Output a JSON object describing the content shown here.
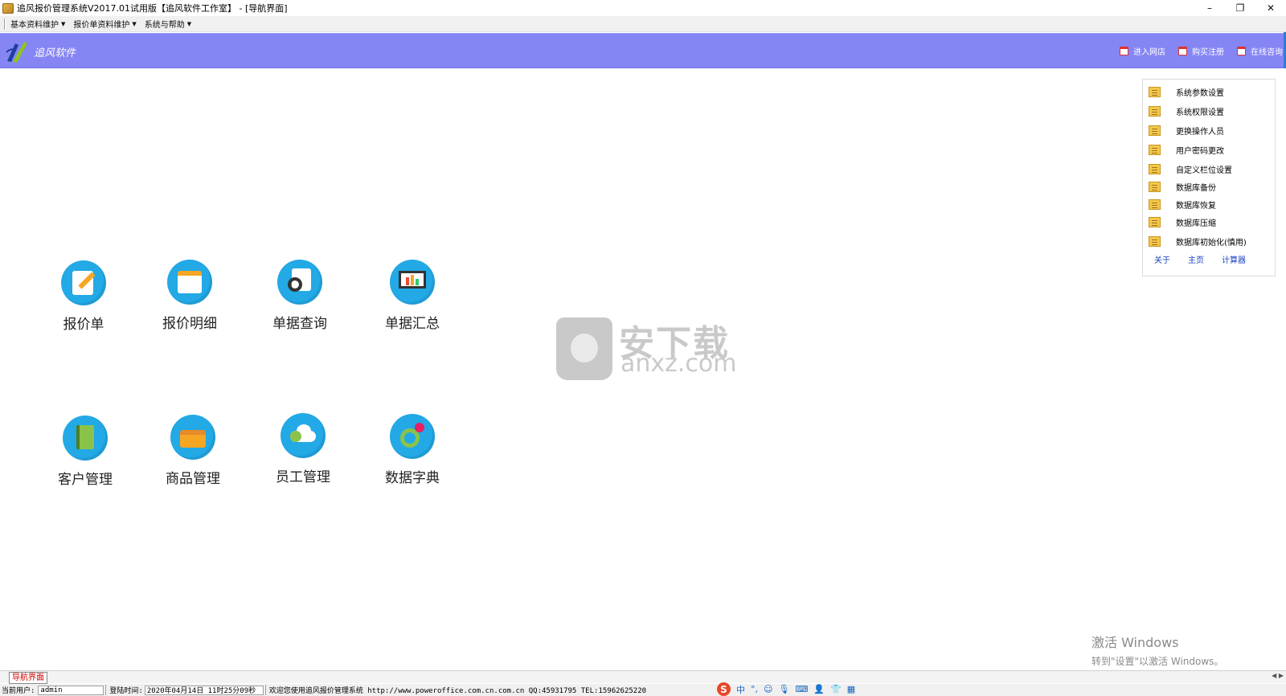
{
  "window": {
    "title": "追风报价管理系统V2017.01试用版【追风软件工作室】 - [导航界面]",
    "controls": [
      "–",
      "❐",
      "✕"
    ]
  },
  "menu": {
    "items": [
      "基本资料维护",
      "报价单资料维护",
      "系统与帮助"
    ]
  },
  "banner": {
    "brand": "追风软件",
    "links": [
      "进入网店",
      "购买注册",
      "在线咨询"
    ]
  },
  "side_panel": {
    "items": [
      "系统参数设置",
      "系统权限设置",
      "更换操作人员",
      "用户密码更改",
      "自定义栏位设置",
      "数据库备份",
      "数据库恢复",
      "数据库压缩",
      "数据库初始化(慎用)"
    ],
    "links": [
      "关于",
      "主页",
      "计算器"
    ]
  },
  "modules": {
    "row1": [
      "报价单",
      "报价明细",
      "单据查询",
      "单据汇总"
    ],
    "row2": [
      "客户管理",
      "商品管理",
      "员工管理",
      "数据字典"
    ]
  },
  "watermark": {
    "cn": "安下载",
    "en": "anxz.com"
  },
  "activation": {
    "line1": "激活 Windows",
    "line2": "转到\"设置\"以激活 Windows。"
  },
  "tabs": {
    "active": "导航界面"
  },
  "status": {
    "user_label": "当前用户:",
    "user_value": "admin",
    "login_label": "登陆时间:",
    "login_value": "2020年04月14日 11时25分09秒",
    "message": "欢迎您使用追风报价管理系统 http://www.poweroffice.com.cn.com.cn QQ:45931795 TEL:15962625220"
  },
  "ime": {
    "logo": "S",
    "mode": "中",
    "punct": "°,"
  },
  "colors": {
    "banner": "#8585f4",
    "icon_circle": "#22a9e6",
    "tab_text": "#d00000",
    "link": "#1a3fbf"
  }
}
